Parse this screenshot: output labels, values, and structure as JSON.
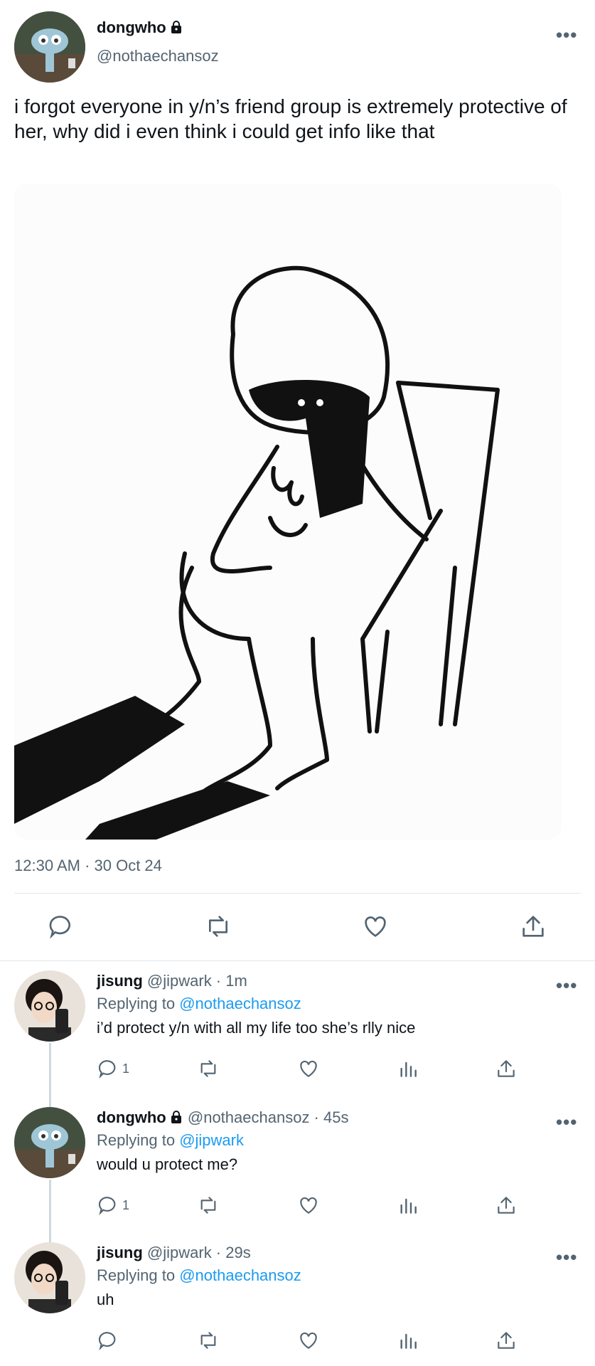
{
  "main_tweet": {
    "display_name": "dongwho",
    "handle": "@nothaechansoz",
    "text": "i forgot everyone in y/n’s friend group is extremely protective of her, why did i even think i could get info like that",
    "timestamp": "12:30 AM · 30 Oct 24"
  },
  "replies": [
    {
      "display_name": "jisung",
      "handle_time": "@jipwark · 1m",
      "replying_prefix": "Replying to",
      "replying_to": "@nothaechansoz",
      "text": "i’d protect y/n with all my life too she’s rlly nice",
      "reply_count": "1"
    },
    {
      "display_name": "dongwho",
      "handle_time": "@nothaechansoz · 45s",
      "replying_prefix": "Replying to",
      "replying_to": "@jipwark",
      "text": "would u protect me?",
      "reply_count": "1"
    },
    {
      "display_name": "jisung",
      "handle_time": "@jipwark · 29s",
      "replying_prefix": "Replying to",
      "replying_to": "@nothaechansoz",
      "text": "uh",
      "reply_count": ""
    }
  ],
  "icons": {
    "more": "more-dots-icon",
    "lock": "lock-icon",
    "reply": "reply-icon",
    "retweet": "retweet-icon",
    "like": "heart-icon",
    "views": "views-icon",
    "share": "share-icon"
  },
  "colors": {
    "link": "#1d9bf0",
    "muted": "#536471",
    "text": "#0f1419"
  },
  "more_glyph": "•••"
}
